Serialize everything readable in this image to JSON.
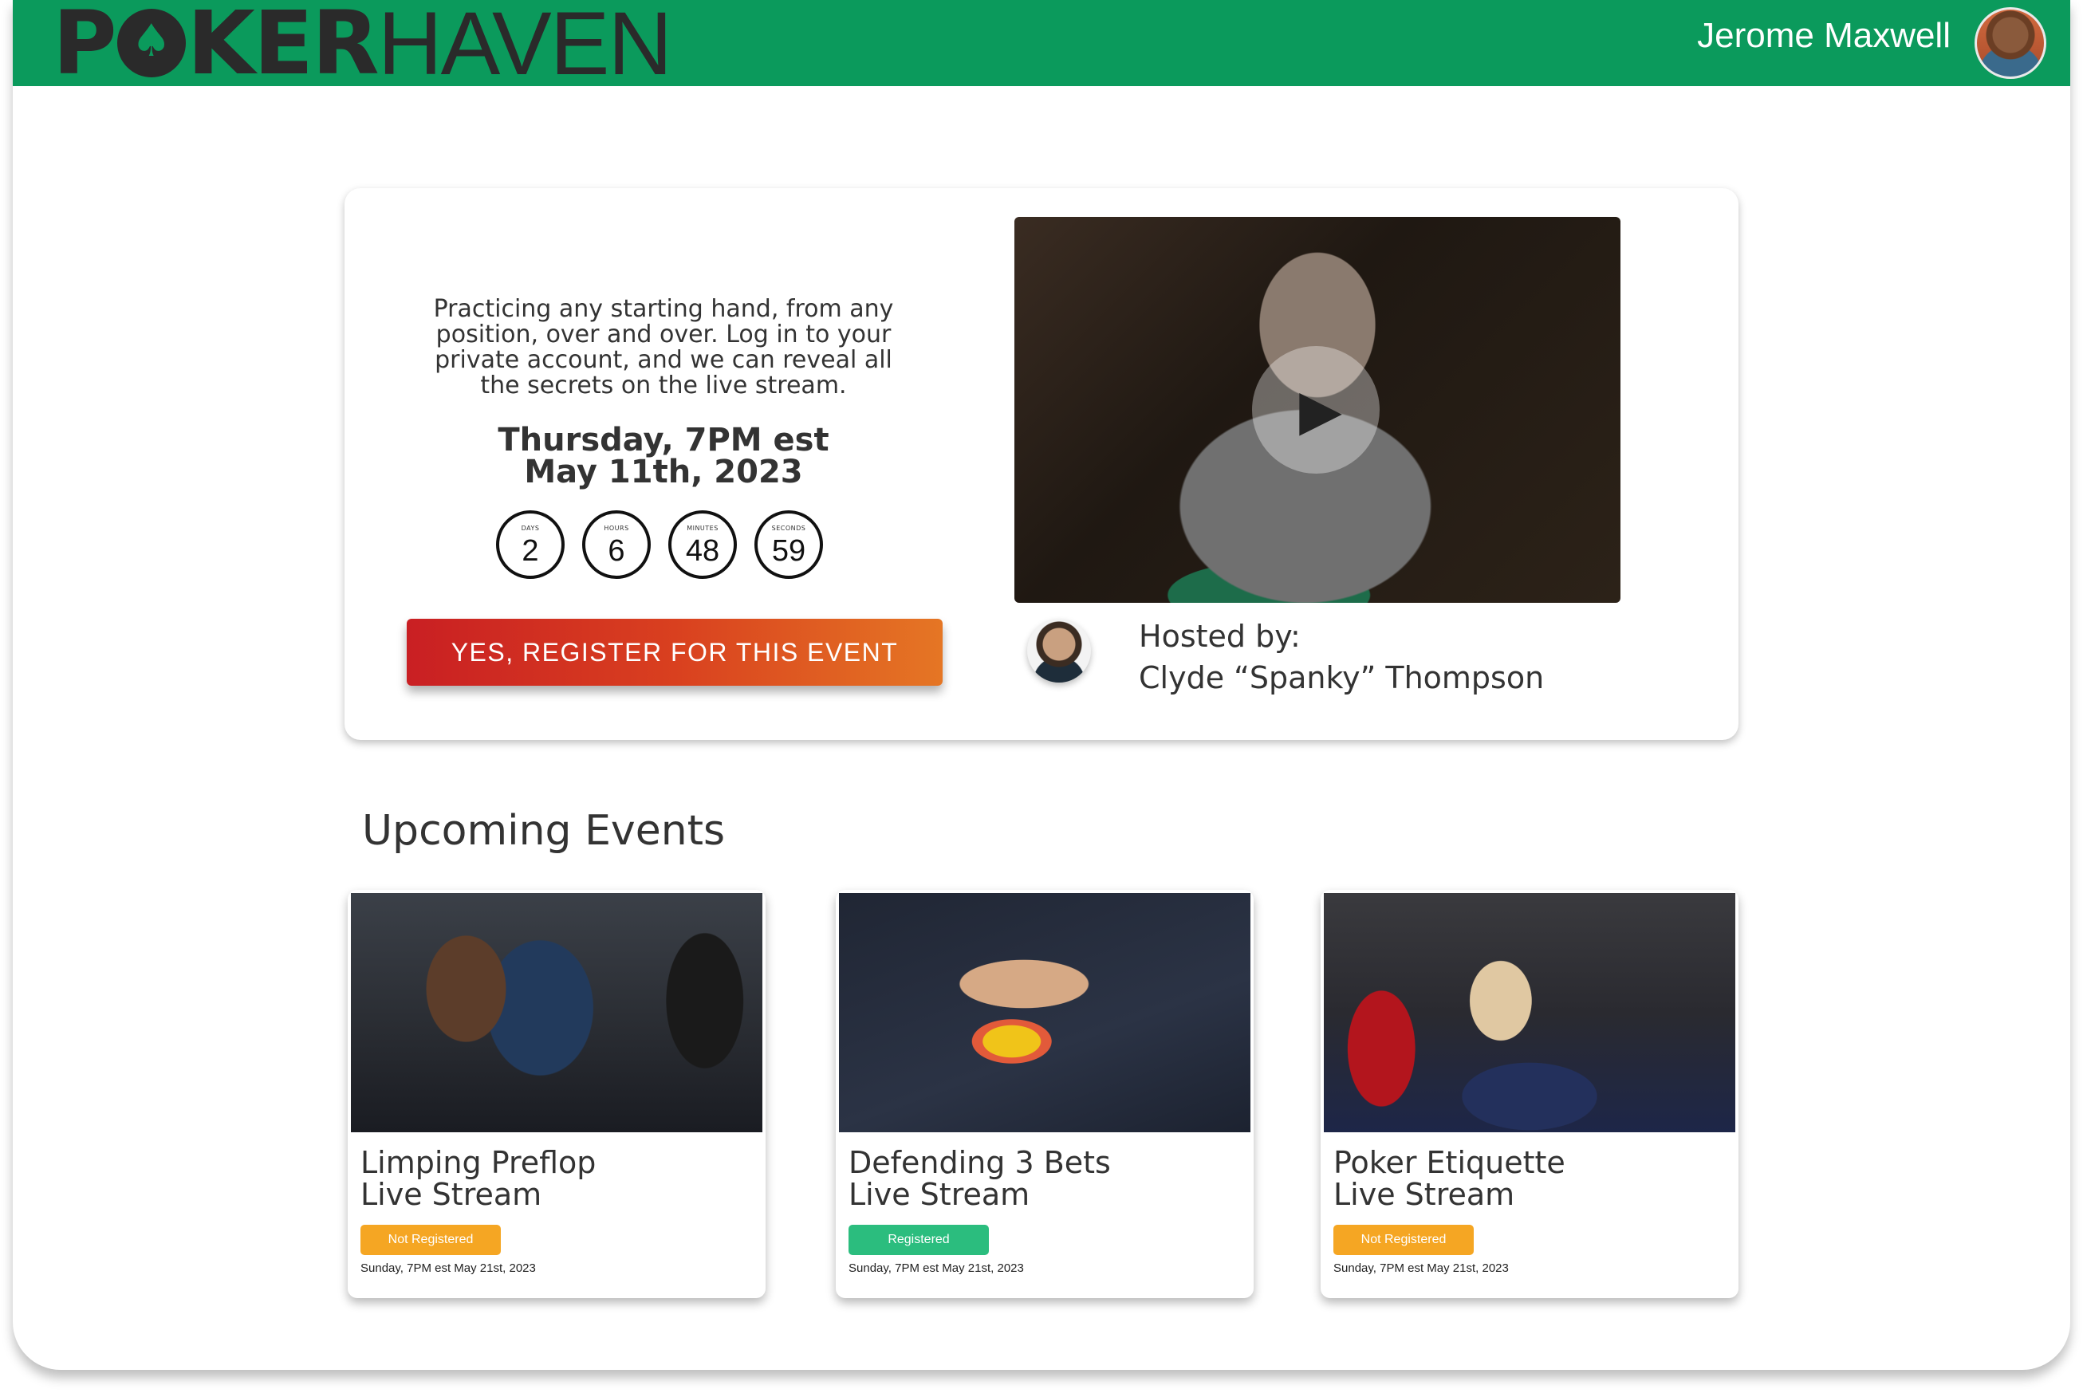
{
  "header": {
    "logo_bold_left": "PO",
    "logo_bold_right": "KER",
    "logo_light": "HAVEN",
    "user_name": "Jerome Maxwell"
  },
  "featured": {
    "description": "Practicing any starting hand, from any position, over and over. Log in to your private account, and we can reveal all the secrets on the live stream.",
    "date_line1": "Thursday, 7PM est",
    "date_line2": "May 11th, 2023",
    "countdown": [
      {
        "unit": "DAYS",
        "value": "2"
      },
      {
        "unit": "HOURS",
        "value": "6"
      },
      {
        "unit": "MINUTES",
        "value": "48"
      },
      {
        "unit": "SECONDS",
        "value": "59"
      }
    ],
    "register_label": "YES, REGISTER FOR THIS EVENT",
    "host_label": "Hosted by:",
    "host_name": "Clyde “Spanky” Thompson"
  },
  "upcoming": {
    "title": "Upcoming Events",
    "events": [
      {
        "title1": "Limping Preflop",
        "title2": "Live Stream",
        "status": "Not Registered",
        "status_color": "#f5a623",
        "date": "Sunday, 7PM est May 21st, 2023"
      },
      {
        "title1": "Defending 3 Bets",
        "title2": "Live Stream",
        "status": "Registered",
        "status_color": "#2bbd7e",
        "date": "Sunday, 7PM est May 21st, 2023"
      },
      {
        "title1": "Poker Etiquette",
        "title2": "Live Stream",
        "status": "Not Registered",
        "status_color": "#f5a623",
        "date": "Sunday, 7PM est May 21st, 2023"
      }
    ]
  },
  "colors": {
    "brand_green": "#0b9a5c",
    "register_gradient_start": "#c91f23",
    "register_gradient_end": "#e57624",
    "not_registered": "#f5a623",
    "registered": "#2bbd7e"
  }
}
